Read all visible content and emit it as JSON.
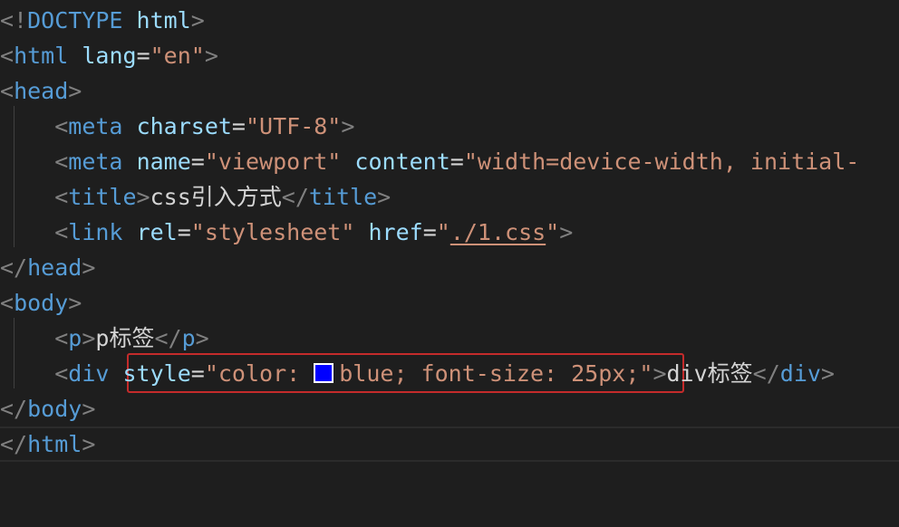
{
  "editor": {
    "lines": [
      {
        "indent": 0,
        "tokens": [
          [
            "punc",
            "<!"
          ],
          [
            "tag",
            "DOCTYPE"
          ],
          [
            "text",
            " "
          ],
          [
            "attr",
            "html"
          ],
          [
            "punc",
            ">"
          ]
        ]
      },
      {
        "indent": 0,
        "tokens": [
          [
            "punc",
            "<"
          ],
          [
            "tag",
            "html"
          ],
          [
            "text",
            " "
          ],
          [
            "attr",
            "lang"
          ],
          [
            "text",
            "="
          ],
          [
            "str",
            "\"en\""
          ],
          [
            "punc",
            ">"
          ]
        ]
      },
      {
        "indent": 0,
        "tokens": [
          [
            "punc",
            "<"
          ],
          [
            "tag",
            "head"
          ],
          [
            "punc",
            ">"
          ]
        ]
      },
      {
        "indent": 1,
        "tokens": [
          [
            "punc",
            "<"
          ],
          [
            "tag",
            "meta"
          ],
          [
            "text",
            " "
          ],
          [
            "attr",
            "charset"
          ],
          [
            "text",
            "="
          ],
          [
            "str",
            "\"UTF-8\""
          ],
          [
            "punc",
            ">"
          ]
        ]
      },
      {
        "indent": 1,
        "tokens": [
          [
            "punc",
            "<"
          ],
          [
            "tag",
            "meta"
          ],
          [
            "text",
            " "
          ],
          [
            "attr",
            "name"
          ],
          [
            "text",
            "="
          ],
          [
            "str",
            "\"viewport\""
          ],
          [
            "text",
            " "
          ],
          [
            "attr",
            "content"
          ],
          [
            "text",
            "="
          ],
          [
            "str",
            "\"width=device-width, initial-"
          ]
        ]
      },
      {
        "indent": 1,
        "tokens": [
          [
            "punc",
            "<"
          ],
          [
            "tag",
            "title"
          ],
          [
            "punc",
            ">"
          ],
          [
            "text",
            "css引入方式"
          ],
          [
            "punc",
            "</"
          ],
          [
            "tag",
            "title"
          ],
          [
            "punc",
            ">"
          ]
        ]
      },
      {
        "indent": 1,
        "tokens": [
          [
            "punc",
            "<"
          ],
          [
            "tag",
            "link"
          ],
          [
            "text",
            " "
          ],
          [
            "attr",
            "rel"
          ],
          [
            "text",
            "="
          ],
          [
            "str",
            "\"stylesheet\""
          ],
          [
            "text",
            " "
          ],
          [
            "attr",
            "href"
          ],
          [
            "text",
            "="
          ],
          [
            "str",
            "\""
          ],
          [
            "link",
            "./1.css"
          ],
          [
            "str",
            "\""
          ],
          [
            "punc",
            ">"
          ]
        ]
      },
      {
        "indent": 0,
        "tokens": [
          [
            "punc",
            "</"
          ],
          [
            "tag",
            "head"
          ],
          [
            "punc",
            ">"
          ]
        ]
      },
      {
        "indent": 0,
        "tokens": [
          [
            "punc",
            "<"
          ],
          [
            "tag",
            "body"
          ],
          [
            "punc",
            ">"
          ]
        ]
      },
      {
        "indent": 1,
        "tokens": [
          [
            "punc",
            "<"
          ],
          [
            "tag",
            "p"
          ],
          [
            "punc",
            ">"
          ],
          [
            "text",
            "p标签"
          ],
          [
            "punc",
            "</"
          ],
          [
            "tag",
            "p"
          ],
          [
            "punc",
            ">"
          ]
        ]
      },
      {
        "indent": 1,
        "tokens": [
          [
            "punc",
            "<"
          ],
          [
            "tag",
            "div"
          ],
          [
            "text",
            " "
          ],
          [
            "attr",
            "style"
          ],
          [
            "text",
            "="
          ],
          [
            "str",
            "\"color: "
          ],
          [
            "swatch",
            ""
          ],
          [
            "str",
            "blue; font-size: 25px;\""
          ],
          [
            "punc",
            ">"
          ],
          [
            "text",
            "div标签"
          ],
          [
            "punc",
            "</"
          ],
          [
            "tag",
            "div"
          ],
          [
            "punc",
            ">"
          ]
        ]
      },
      {
        "indent": 0,
        "tokens": [
          [
            "punc",
            "</"
          ],
          [
            "tag",
            "body"
          ],
          [
            "punc",
            ">"
          ]
        ]
      },
      {
        "indent": 0,
        "tokens": [
          [
            "punc",
            "</"
          ],
          [
            "tag",
            "html"
          ],
          [
            "punc",
            ">"
          ]
        ]
      }
    ],
    "current_line": 12,
    "swatch_color": "#0000ff"
  },
  "colors": {
    "background": "#1e1e1e",
    "punctuation": "#808080",
    "tag": "#569cd6",
    "attribute": "#9cdcfe",
    "string": "#ce9178",
    "text": "#d4d4d4",
    "highlight_border": "#c42b2b"
  }
}
